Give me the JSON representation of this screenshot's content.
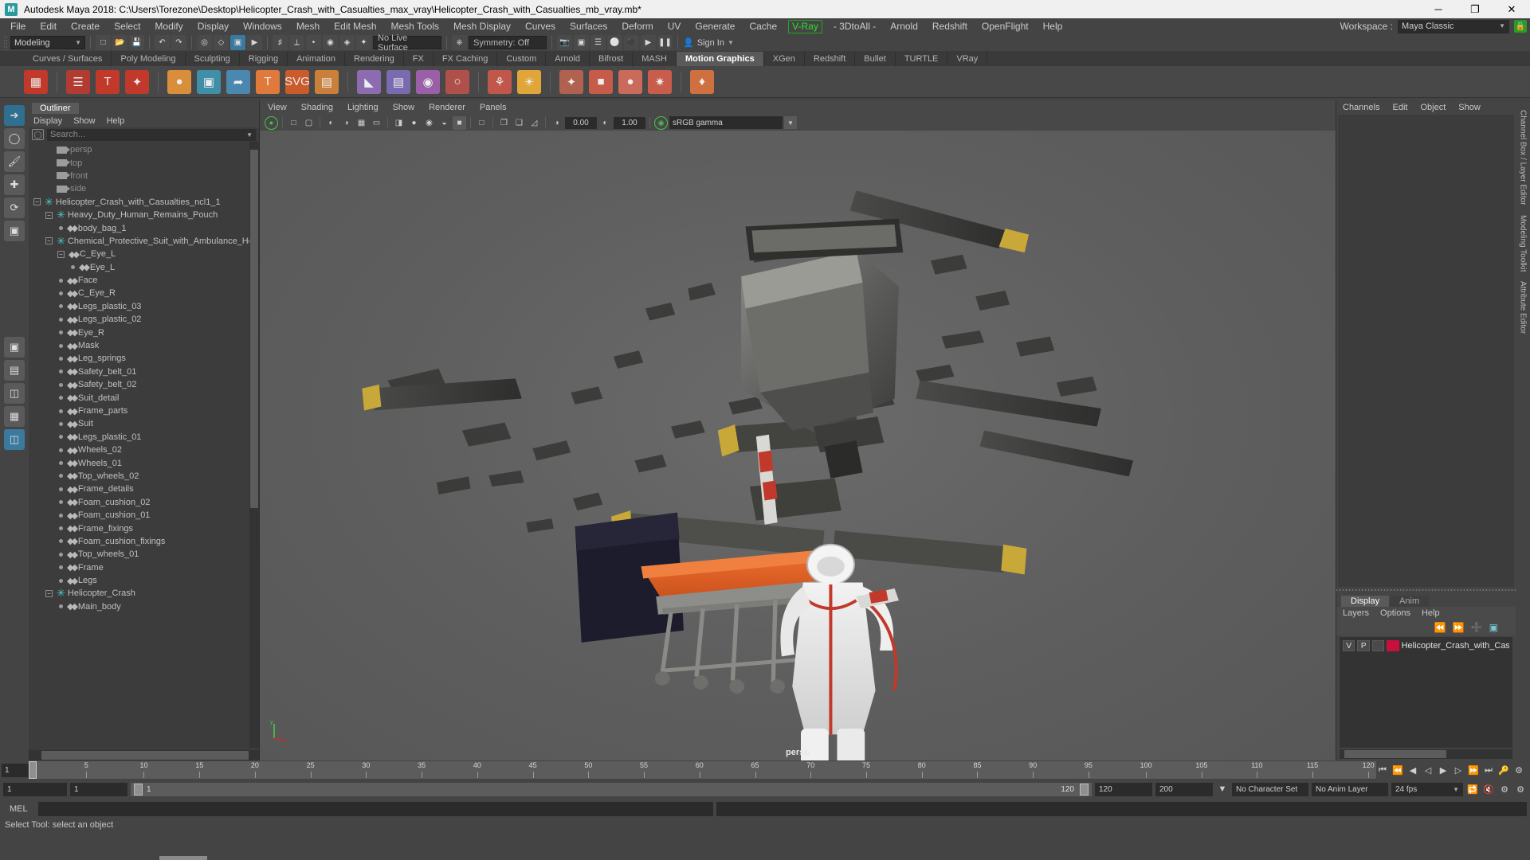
{
  "titlebar": {
    "app_title": "Autodesk Maya 2018: C:\\Users\\Torezone\\Desktop\\Helicopter_Crash_with_Casualties_max_vray\\Helicopter_Crash_with_Casualties_mb_vray.mb*",
    "logo": "M",
    "minimize": "─",
    "maximize": "❐",
    "close": "✕"
  },
  "menubar": {
    "items": [
      "File",
      "Edit",
      "Create",
      "Select",
      "Modify",
      "Display",
      "Windows",
      "Mesh",
      "Edit Mesh",
      "Mesh Tools",
      "Mesh Display",
      "Curves",
      "Surfaces",
      "Deform",
      "UV",
      "Generate",
      "Cache"
    ],
    "vray": "V-Ray",
    "items_after": [
      "- 3DtoAll -",
      "Arnold",
      "Redshift",
      "OpenFlight",
      "Help"
    ],
    "workspace_label": "Workspace :",
    "workspace_value": "Maya Classic",
    "lock_icon": "🔒"
  },
  "statusrow": {
    "mode": "Modeling",
    "live_surface": "No Live Surface",
    "symmetry": "Symmetry: Off",
    "signin": "Sign In",
    "search_placeholder": ""
  },
  "shelf": {
    "tabs": [
      "Curves / Surfaces",
      "Poly Modeling",
      "Sculpting",
      "Rigging",
      "Animation",
      "Rendering",
      "FX",
      "FX Caching",
      "Custom",
      "Arnold",
      "Bifrost",
      "MASH",
      "Motion Graphics",
      "XGen",
      "Redshift",
      "Bullet",
      "TURTLE",
      "VRay"
    ],
    "active_tab": "Motion Graphics"
  },
  "outliner": {
    "tab": "Outliner",
    "menu": [
      "Display",
      "Show",
      "Help"
    ],
    "search_placeholder": "Search...",
    "tree": [
      {
        "label": "persp",
        "icon": "camera-icon",
        "depth": 1,
        "toggle": "",
        "dim": true
      },
      {
        "label": "top",
        "icon": "camera-icon",
        "depth": 1,
        "toggle": "",
        "dim": true
      },
      {
        "label": "front",
        "icon": "camera-icon",
        "depth": 1,
        "toggle": "",
        "dim": true
      },
      {
        "label": "side",
        "icon": "camera-icon",
        "depth": 1,
        "toggle": "",
        "dim": true
      },
      {
        "label": "Helicopter_Crash_with_Casualties_ncl1_1",
        "icon": "group-icon",
        "depth": 0,
        "toggle": "minus",
        "dim": false
      },
      {
        "label": "Heavy_Duty_Human_Remains_Pouch",
        "icon": "group-icon",
        "depth": 1,
        "toggle": "minus",
        "dim": false
      },
      {
        "label": "body_bag_1",
        "icon": "mesh-icon",
        "depth": 2,
        "toggle": "dot",
        "dim": false
      },
      {
        "label": "Chemical_Protective_Suit_with_Ambulance_Hospital",
        "icon": "group-icon",
        "depth": 1,
        "toggle": "minus",
        "dim": false
      },
      {
        "label": "C_Eye_L",
        "icon": "mesh-icon",
        "depth": 2,
        "toggle": "minus",
        "dim": false
      },
      {
        "label": "Eye_L",
        "icon": "mesh-icon",
        "depth": 3,
        "toggle": "dot",
        "dim": false
      },
      {
        "label": "Face",
        "icon": "mesh-icon",
        "depth": 2,
        "toggle": "dot",
        "dim": false
      },
      {
        "label": "C_Eye_R",
        "icon": "mesh-icon",
        "depth": 2,
        "toggle": "dot",
        "dim": false
      },
      {
        "label": "Legs_plastic_03",
        "icon": "mesh-icon",
        "depth": 2,
        "toggle": "dot",
        "dim": false
      },
      {
        "label": "Legs_plastic_02",
        "icon": "mesh-icon",
        "depth": 2,
        "toggle": "dot",
        "dim": false
      },
      {
        "label": "Eye_R",
        "icon": "mesh-icon",
        "depth": 2,
        "toggle": "dot",
        "dim": false
      },
      {
        "label": "Mask",
        "icon": "mesh-icon",
        "depth": 2,
        "toggle": "dot",
        "dim": false
      },
      {
        "label": "Leg_springs",
        "icon": "mesh-icon",
        "depth": 2,
        "toggle": "dot",
        "dim": false
      },
      {
        "label": "Safety_belt_01",
        "icon": "mesh-icon",
        "depth": 2,
        "toggle": "dot",
        "dim": false
      },
      {
        "label": "Safety_belt_02",
        "icon": "mesh-icon",
        "depth": 2,
        "toggle": "dot",
        "dim": false
      },
      {
        "label": "Suit_detail",
        "icon": "mesh-icon",
        "depth": 2,
        "toggle": "dot",
        "dim": false
      },
      {
        "label": "Frame_parts",
        "icon": "mesh-icon",
        "depth": 2,
        "toggle": "dot",
        "dim": false
      },
      {
        "label": "Suit",
        "icon": "mesh-icon",
        "depth": 2,
        "toggle": "dot",
        "dim": false
      },
      {
        "label": "Legs_plastic_01",
        "icon": "mesh-icon",
        "depth": 2,
        "toggle": "dot",
        "dim": false
      },
      {
        "label": "Wheels_02",
        "icon": "mesh-icon",
        "depth": 2,
        "toggle": "dot",
        "dim": false
      },
      {
        "label": "Wheels_01",
        "icon": "mesh-icon",
        "depth": 2,
        "toggle": "dot",
        "dim": false
      },
      {
        "label": "Top_wheels_02",
        "icon": "mesh-icon",
        "depth": 2,
        "toggle": "dot",
        "dim": false
      },
      {
        "label": "Frame_details",
        "icon": "mesh-icon",
        "depth": 2,
        "toggle": "dot",
        "dim": false
      },
      {
        "label": "Foam_cushion_02",
        "icon": "mesh-icon",
        "depth": 2,
        "toggle": "dot",
        "dim": false
      },
      {
        "label": "Foam_cushion_01",
        "icon": "mesh-icon",
        "depth": 2,
        "toggle": "dot",
        "dim": false
      },
      {
        "label": "Frame_fixings",
        "icon": "mesh-icon",
        "depth": 2,
        "toggle": "dot",
        "dim": false
      },
      {
        "label": "Foam_cushion_fixings",
        "icon": "mesh-icon",
        "depth": 2,
        "toggle": "dot",
        "dim": false
      },
      {
        "label": "Top_wheels_01",
        "icon": "mesh-icon",
        "depth": 2,
        "toggle": "dot",
        "dim": false
      },
      {
        "label": "Frame",
        "icon": "mesh-icon",
        "depth": 2,
        "toggle": "dot",
        "dim": false
      },
      {
        "label": "Legs",
        "icon": "mesh-icon",
        "depth": 2,
        "toggle": "dot",
        "dim": false
      },
      {
        "label": "Helicopter_Crash",
        "icon": "group-icon",
        "depth": 1,
        "toggle": "minus",
        "dim": false
      },
      {
        "label": "Main_body",
        "icon": "mesh-icon",
        "depth": 2,
        "toggle": "dot",
        "dim": false
      }
    ]
  },
  "viewport": {
    "menu": [
      "View",
      "Shading",
      "Lighting",
      "Show",
      "Renderer",
      "Panels"
    ],
    "exposure": "0.00",
    "gamma_value": "1.00",
    "color_profile": "sRGB gamma",
    "camera_label": "persp"
  },
  "right_panel": {
    "menu": [
      "Channels",
      "Edit",
      "Object",
      "Show"
    ],
    "layers": {
      "tabs": [
        "Display",
        "Anim"
      ],
      "active_tab": "Display",
      "menu": [
        "Layers",
        "Options",
        "Help"
      ],
      "columns": [
        "V",
        "P"
      ],
      "rows": [
        {
          "v": "V",
          "p": "P",
          "extra": "",
          "color": "#c8103c",
          "name": "Helicopter_Crash_with_Casual"
        }
      ]
    },
    "vertical_tabs": [
      "Channel Box / Layer Editor",
      "Modeling Toolkit",
      "Attribute Editor"
    ]
  },
  "timeline": {
    "current_frame": "1",
    "ticks": [
      "5",
      "10",
      "15",
      "20",
      "25",
      "30",
      "35",
      "40",
      "45",
      "50",
      "55",
      "60",
      "65",
      "70",
      "75",
      "80",
      "85",
      "90",
      "95",
      "100",
      "105",
      "110",
      "115",
      "120"
    ],
    "playback_frame": "1",
    "range_start": "1",
    "range_start2": "1",
    "range_bar_start": "1",
    "range_bar_end": "120",
    "range_end": "120",
    "anim_end": "200",
    "character_set": "No Character Set",
    "anim_layer": "No Anim Layer",
    "fps": "24 fps"
  },
  "command": {
    "mel_label": "MEL",
    "mel_value": "",
    "status": "Select Tool: select an object"
  }
}
